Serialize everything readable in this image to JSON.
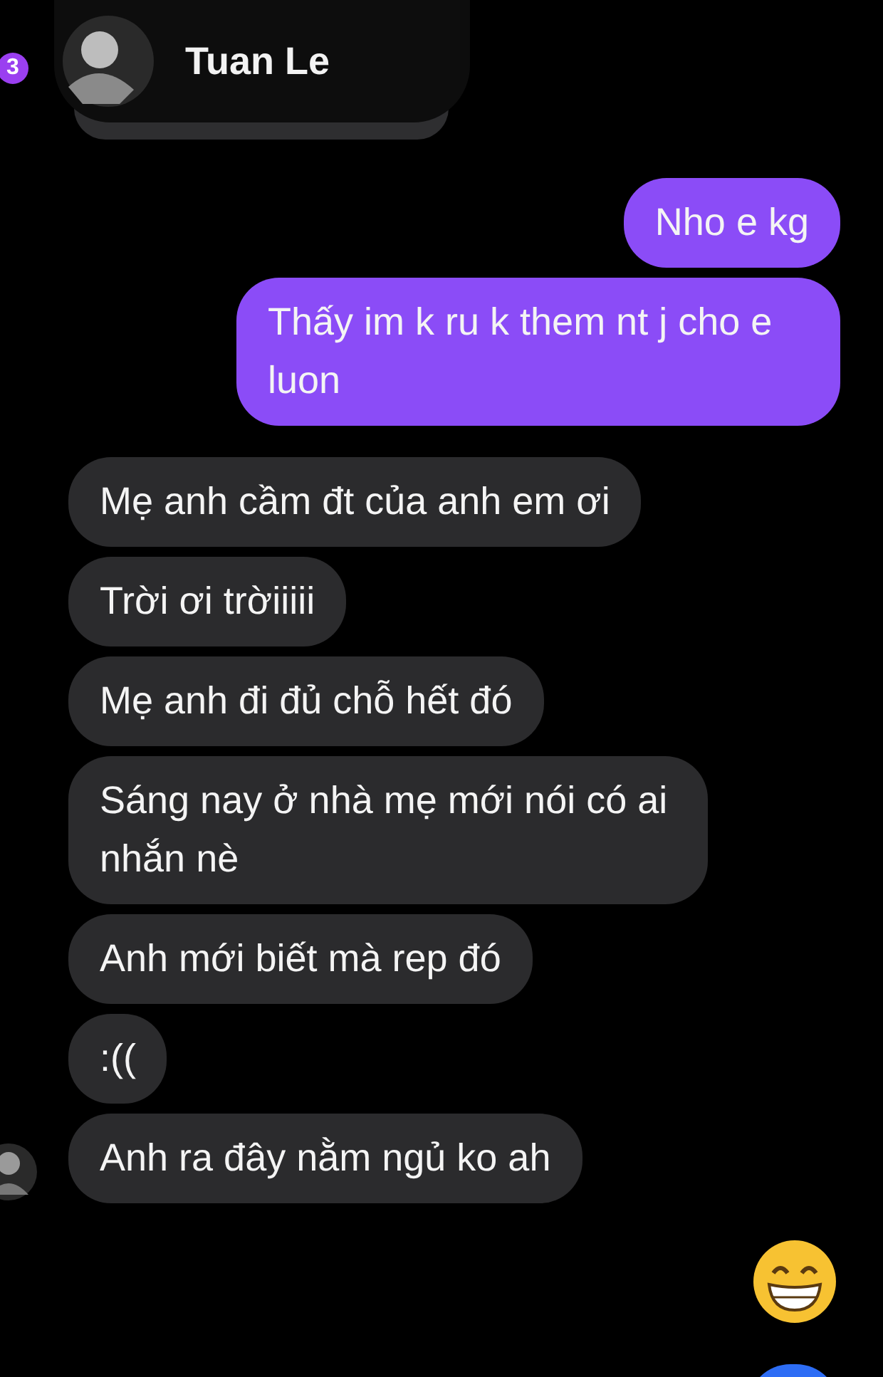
{
  "header": {
    "badge": "3",
    "name": "Tuan Le"
  },
  "messages": [
    {
      "kind": "sent",
      "text": "Nho e kg"
    },
    {
      "kind": "sent",
      "text": "Thấy im k ru k them nt j cho e luon"
    },
    {
      "kind": "received",
      "text": "Mẹ anh cầm đt của anh em ơi"
    },
    {
      "kind": "received",
      "text": "Trời ơi trờiiiii"
    },
    {
      "kind": "received",
      "text": "Mẹ anh đi đủ chỗ hết đó"
    },
    {
      "kind": "received",
      "text": "Sáng nay ở nhà mẹ mới nói có ai nhắn nè"
    },
    {
      "kind": "received",
      "text": "Anh mới biết mà rep đó"
    },
    {
      "kind": "received",
      "text": ":(("
    },
    {
      "kind": "received",
      "text": "Anh ra đây nằm ngủ ko ah",
      "avatar": true
    }
  ]
}
